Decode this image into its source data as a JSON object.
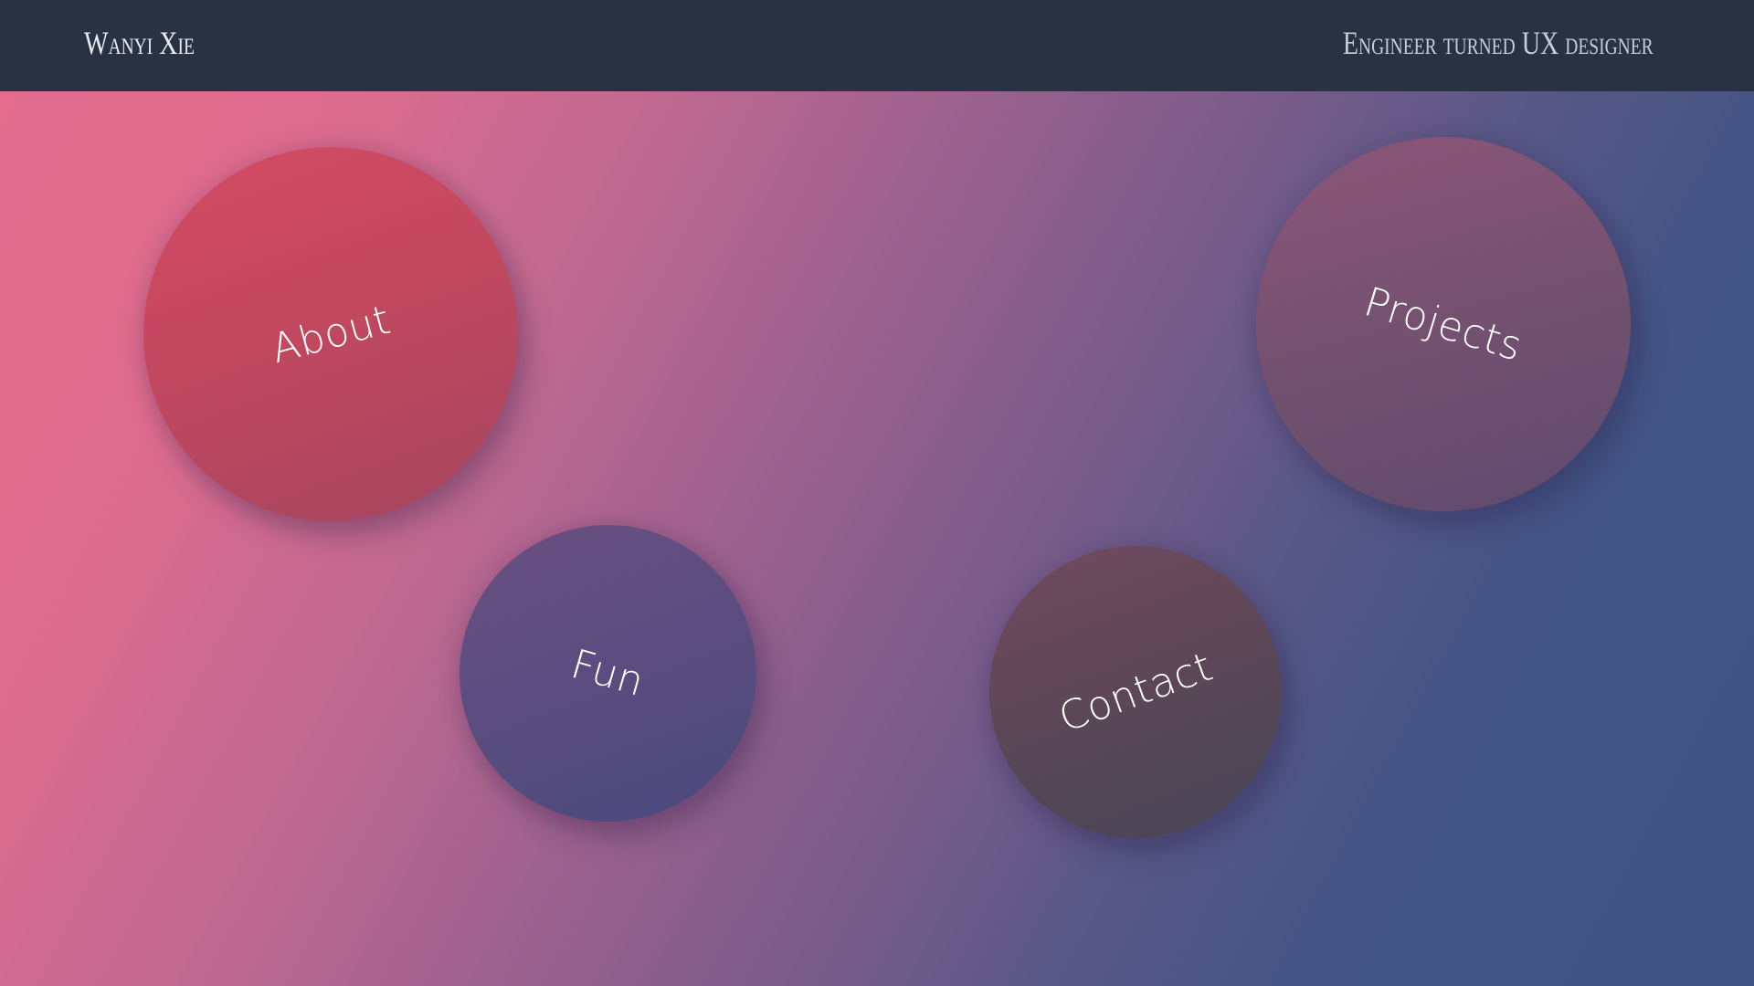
{
  "header": {
    "brand": "Wanyi Xie",
    "tagline": "Engineer turned UX designer"
  },
  "nav": {
    "about": "About",
    "projects": "Projects",
    "fun": "Fun",
    "contact": "Contact"
  },
  "colors": {
    "header_bg": "#283243",
    "gradient_start": "#e36c8f",
    "gradient_end": "#3f5484",
    "about_bubble": "#c2485f",
    "projects_bubble": "#74516f",
    "fun_bubble": "#5a4c7f",
    "contact_bubble": "#5b4757"
  }
}
